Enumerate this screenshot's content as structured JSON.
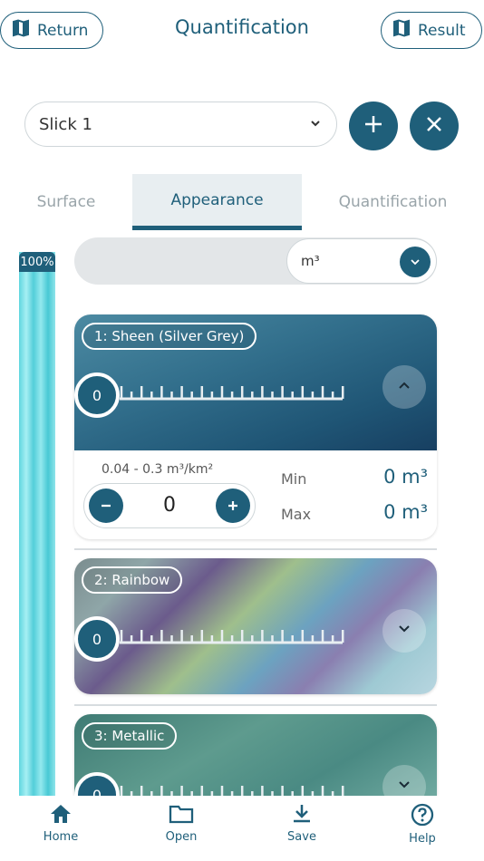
{
  "header": {
    "return_label": "Return",
    "title": "Quantification",
    "result_label": "Result"
  },
  "slick_select": {
    "value": "Slick 1"
  },
  "tabs": [
    {
      "label": "Surface"
    },
    {
      "label": "Appearance",
      "active": true
    },
    {
      "label": "Quantification"
    }
  ],
  "level_bar": {
    "label": "100%",
    "level": 100
  },
  "unit_select": {
    "value": "m³"
  },
  "cards": [
    {
      "tag": "1: Sheen (Silver Grey)",
      "knob_value": "0",
      "expanded": true,
      "range": "0.04 - 0.3 m³/km²",
      "stepper_value": "0",
      "min_label": "Min",
      "min_value": "0 m³",
      "max_label": "Max",
      "max_value": "0 m³"
    },
    {
      "tag": "2: Rainbow",
      "knob_value": "0",
      "expanded": false
    },
    {
      "tag": "3: Metallic",
      "knob_value": "0",
      "expanded": false
    }
  ],
  "bottom_nav": [
    {
      "label": "Home",
      "icon": "home-icon"
    },
    {
      "label": "Open",
      "icon": "folder-icon"
    },
    {
      "label": "Save",
      "icon": "download-icon"
    },
    {
      "label": "Help",
      "icon": "help-icon"
    }
  ],
  "colors": {
    "primary": "#1f5f7a",
    "tab_active_bg": "#e8eef1"
  }
}
